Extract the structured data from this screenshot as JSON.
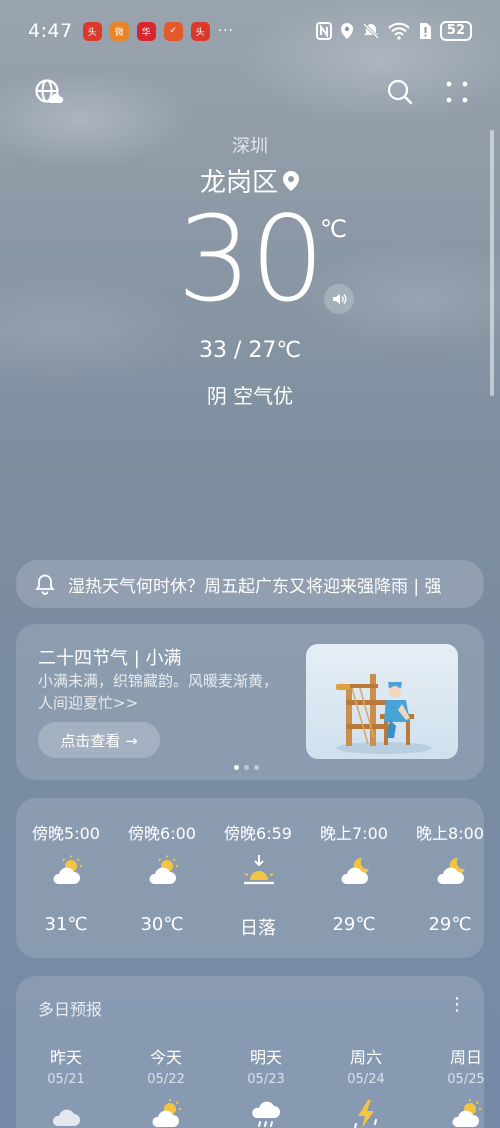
{
  "status": {
    "time": "4:47",
    "dots": "···",
    "battery": "52",
    "app_icons": [
      {
        "name": "news-app-icon",
        "color": "#d93a2b",
        "label": "头条"
      },
      {
        "name": "weibo-icon",
        "color": "#e65a2a",
        "label": "微"
      },
      {
        "name": "huawei-app-icon",
        "color": "#d8262f",
        "label": "华"
      },
      {
        "name": "delivery-app-icon",
        "color": "#e04a2a",
        "label": "✓"
      },
      {
        "name": "news-app-icon-2",
        "color": "#d93a2b",
        "label": "头条"
      }
    ]
  },
  "header": {
    "city": "深圳",
    "district": "龙岗区",
    "temperature": "30",
    "unit": "℃",
    "range": "33 / 27℃",
    "condition": "阴  空气优"
  },
  "alert": {
    "text": "湿热天气何时休？周五起广东又将迎来强降雨 | 强"
  },
  "solar_term": {
    "title": "二十四节气 | 小满",
    "desc": "小满未满，织锦藏韵。风暖麦渐黄，人间迎夏忙>>",
    "button": "点击查看 →",
    "page_count": 3,
    "active_page": 0
  },
  "hourly": [
    {
      "time": "傍晚5:00",
      "icon": "partly-cloudy-sun-icon",
      "value": "31℃"
    },
    {
      "time": "傍晚6:00",
      "icon": "partly-cloudy-sun-icon",
      "value": "30℃"
    },
    {
      "time": "傍晚6:59",
      "icon": "sunset-icon",
      "value": "日落"
    },
    {
      "time": "晚上7:00",
      "icon": "partly-cloudy-moon-icon",
      "value": "29℃"
    },
    {
      "time": "晚上8:00",
      "icon": "partly-cloudy-moon-icon",
      "value": "29℃"
    }
  ],
  "forecast": {
    "title": "多日预报",
    "more": "⋮",
    "days": [
      {
        "day": "昨天",
        "date": "05/21",
        "icon": "cloud-icon"
      },
      {
        "day": "今天",
        "date": "05/22",
        "icon": "partly-cloudy-sun-icon"
      },
      {
        "day": "明天",
        "date": "05/23",
        "icon": "rain-cloud-icon"
      },
      {
        "day": "周六",
        "date": "05/24",
        "icon": "thunder-icon"
      },
      {
        "day": "周日",
        "date": "05/25",
        "icon": "partly-cloudy-sun-icon"
      }
    ]
  }
}
